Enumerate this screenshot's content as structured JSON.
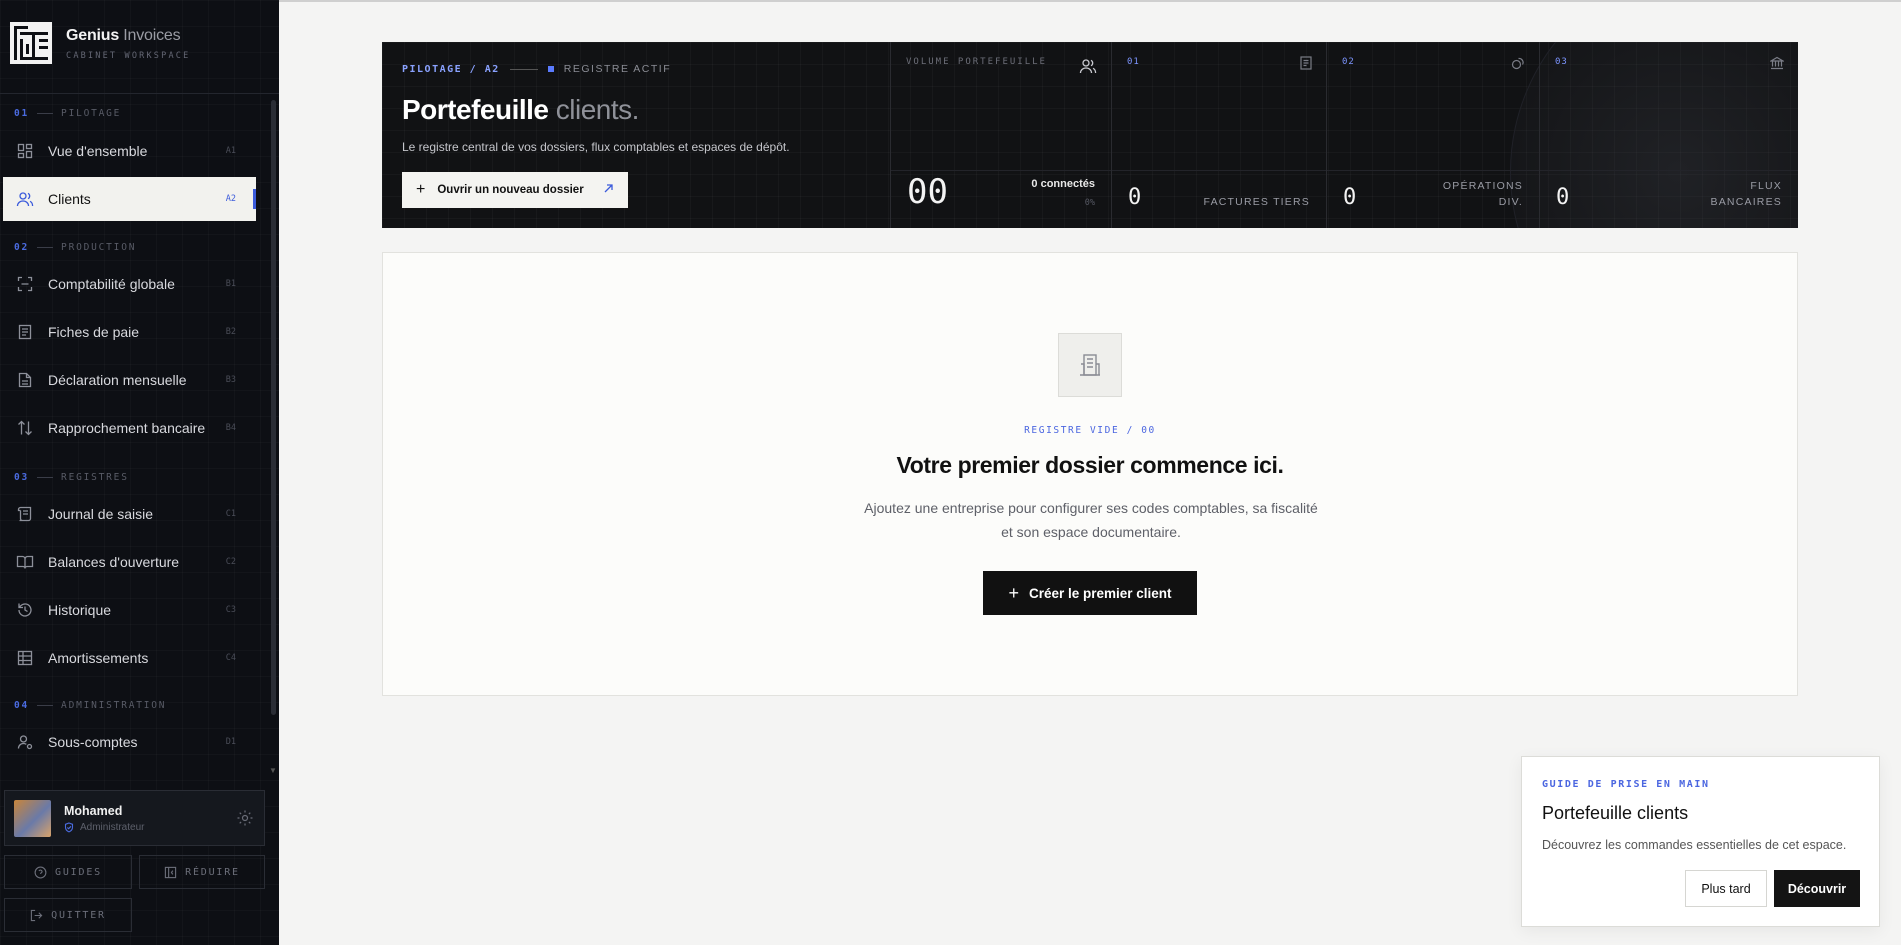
{
  "brand": {
    "name": "Genius",
    "name_suffix": "Invoices",
    "subtitle": "CABINET WORKSPACE"
  },
  "sections": [
    {
      "num": "01",
      "label": "PILOTAGE"
    },
    {
      "num": "02",
      "label": "PRODUCTION"
    },
    {
      "num": "03",
      "label": "REGISTRES"
    },
    {
      "num": "04",
      "label": "ADMINISTRATION"
    }
  ],
  "nav": [
    {
      "label": "Vue d'ensemble",
      "code": "A1",
      "icon": "grid-icon"
    },
    {
      "label": "Clients",
      "code": "A2",
      "icon": "users-icon",
      "active": true
    },
    {
      "label": "Comptabilité globale",
      "code": "B1",
      "icon": "scan-icon"
    },
    {
      "label": "Fiches de paie",
      "code": "B2",
      "icon": "document-icon"
    },
    {
      "label": "Déclaration mensuelle",
      "code": "B3",
      "icon": "file-list-icon"
    },
    {
      "label": "Rapprochement bancaire",
      "code": "B4",
      "icon": "arrows-updown-icon"
    },
    {
      "label": "Journal de saisie",
      "code": "C1",
      "icon": "scroll-icon"
    },
    {
      "label": "Balances d'ouverture",
      "code": "C2",
      "icon": "book-open-icon"
    },
    {
      "label": "Historique",
      "code": "C3",
      "icon": "history-icon"
    },
    {
      "label": "Amortissements",
      "code": "C4",
      "icon": "table-icon"
    },
    {
      "label": "Sous-comptes",
      "code": "D1",
      "icon": "user-cog-icon"
    }
  ],
  "user": {
    "name": "Mohamed",
    "role": "Administrateur"
  },
  "sidebar_buttons": {
    "guides": "GUIDES",
    "reduce": "RÉDUIRE",
    "quit": "QUITTER"
  },
  "hero": {
    "breadcrumb": "PILOTAGE / A2",
    "status": "REGISTRE ACTIF",
    "title": "Portefeuille",
    "title_suffix": "clients.",
    "description": "Le registre central de vos dossiers, flux comptables et espaces de dépôt.",
    "cta": "Ouvrir un nouveau dossier"
  },
  "stats": {
    "volume": {
      "header": "VOLUME PORTEFEUILLE",
      "value": "00",
      "connected": "0 connectés",
      "pct": "0%"
    },
    "s1": {
      "header": "01",
      "value": "0",
      "label": "FACTURES TIERS"
    },
    "s2": {
      "header": "02",
      "value": "0",
      "label_1": "OPÉRATIONS",
      "label_2": "DIV."
    },
    "s3": {
      "header": "03",
      "value": "0",
      "label_1": "FLUX",
      "label_2": "BANCAIRES"
    }
  },
  "empty": {
    "tag": "REGISTRE VIDE / 00",
    "title": "Votre premier dossier commence ici.",
    "description": "Ajoutez une entreprise pour configurer ses codes comptables, sa fiscalité et son espace documentaire.",
    "button": "Créer le premier client"
  },
  "guide": {
    "tag": "GUIDE DE PRISE EN MAIN",
    "title": "Portefeuille clients",
    "description": "Découvrez les commandes essentielles de cet espace.",
    "later": "Plus tard",
    "discover": "Découvrir"
  },
  "colors": {
    "accent": "#3b5bdb",
    "sidebar_bg": "#0d0f14",
    "hero_bg": "#111214"
  }
}
